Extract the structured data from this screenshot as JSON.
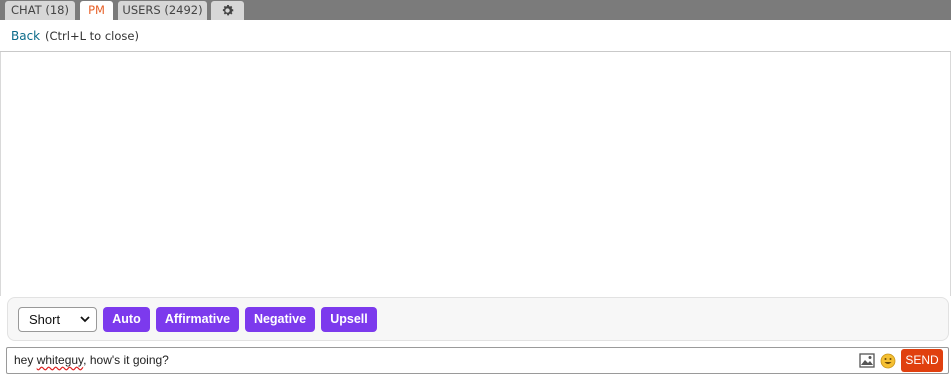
{
  "tabs": {
    "chat": "CHAT (18)",
    "pm": "PM",
    "users": "USERS (2492)",
    "settings_icon": "gear-icon"
  },
  "pm": {
    "back_label": "Back",
    "close_hint": "(Ctrl+L to close)"
  },
  "quick_replies": {
    "length_selected": "Short",
    "auto": "Auto",
    "affirmative": "Affirmative",
    "negative": "Negative",
    "upsell": "Upsell",
    "button_color": "#7c3aed"
  },
  "composer": {
    "value_prefix": "hey ",
    "value_misspelled": "whiteguy",
    "value_suffix": ", how's it going?",
    "image_icon": "image-icon",
    "emoji_icon": "emoji-icon",
    "send_label": "SEND",
    "send_color": "#e0400f"
  }
}
